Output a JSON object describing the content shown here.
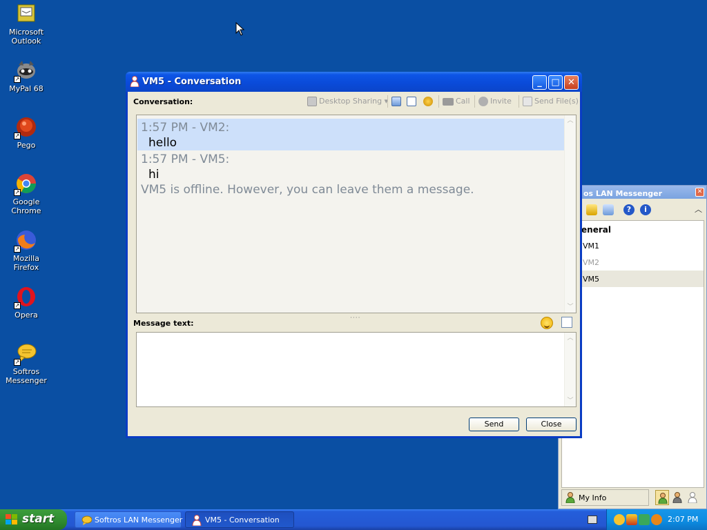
{
  "desktop": {
    "icons": [
      {
        "label_line1": "Microsoft",
        "label_line2": "Outlook",
        "icon": "outlook-icon"
      },
      {
        "label_line1": "MyPal 68",
        "label_line2": "",
        "icon": "mypal-icon"
      },
      {
        "label_line1": "Pego",
        "label_line2": "",
        "icon": "pego-icon"
      },
      {
        "label_line1": "Google Chrome",
        "label_line2": "",
        "icon": "chrome-icon"
      },
      {
        "label_line1": "Mozilla Firefox",
        "label_line2": "",
        "icon": "firefox-icon"
      },
      {
        "label_line1": "Opera",
        "label_line2": "",
        "icon": "opera-icon"
      },
      {
        "label_line1": "Softros",
        "label_line2": "Messenger",
        "icon": "softros-icon"
      }
    ]
  },
  "conversation": {
    "title": "VM5 - Conversation",
    "conversation_label": "Conversation:",
    "toolbar": {
      "desktop_sharing": "Desktop Sharing",
      "call": "Call",
      "invite": "Invite",
      "send_files": "Send File(s)"
    },
    "messages": [
      {
        "header": "1:57 PM - VM2:",
        "text": "hello",
        "highlighted": true
      },
      {
        "header": "1:57 PM - VM5:",
        "text": "hi",
        "highlighted": false
      }
    ],
    "system_note": "VM5 is offline. However, you can leave them a message.",
    "message_text_label": "Message text:",
    "input_value": "",
    "send_label": "Send",
    "close_label": "Close"
  },
  "messenger": {
    "title": "os LAN Messenger",
    "group": "General",
    "contacts": [
      {
        "name": "VM1",
        "status": "online"
      },
      {
        "name": "VM2",
        "status": "offline"
      },
      {
        "name": "VM5",
        "status": "selected"
      }
    ],
    "my_info": "My Info"
  },
  "taskbar": {
    "start_label": "start",
    "tasks": [
      {
        "label": "Softros LAN Messenger",
        "active": false
      },
      {
        "label": "VM5 - Conversation",
        "active": true
      }
    ],
    "clock": "2:07 PM"
  },
  "colors": {
    "desktop_bg": "#0a4fa3",
    "title_bar": "#0a4ad8",
    "highlight_row": "#cde0fa",
    "start_green": "#2f8a2f"
  }
}
